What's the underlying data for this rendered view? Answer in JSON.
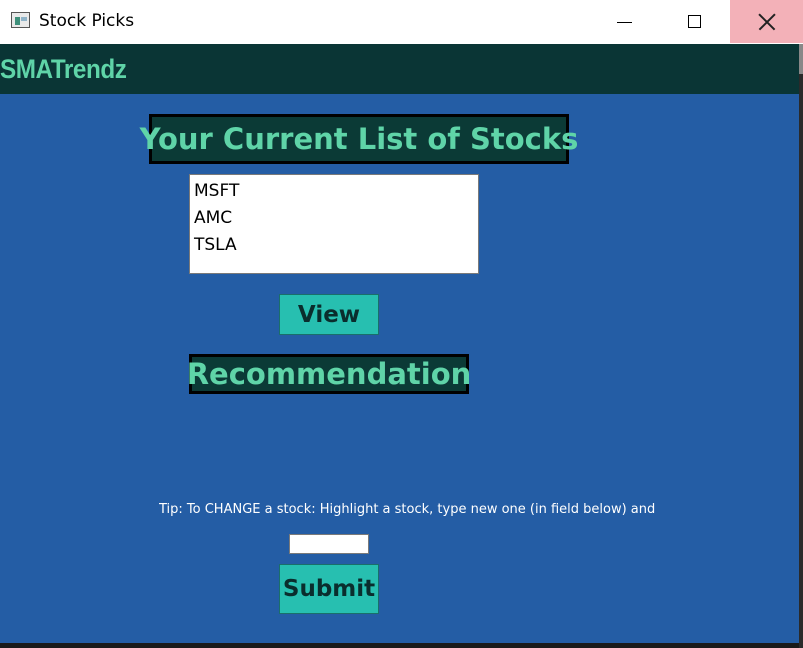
{
  "window": {
    "title": "Stock Picks",
    "controls": [
      "minimize-icon",
      "maximize-icon",
      "close-icon"
    ]
  },
  "header": {
    "brand": "SMATrendz"
  },
  "stocks_section": {
    "heading": "Your Current List of Stocks",
    "items": [
      "MSFT",
      "AMC",
      "TSLA"
    ]
  },
  "buttons": {
    "view": "View",
    "submit": "Submit"
  },
  "recommendation": {
    "heading": "Recommendation"
  },
  "tip": {
    "text": "Tip: To CHANGE a stock: Highlight a stock, type new one (in field below) and click S"
  },
  "entry": {
    "value": "",
    "placeholder": ""
  },
  "colors": {
    "header_bg": "#0a3535",
    "brand_text": "#5fd4a8",
    "main_bg": "#245da5",
    "heading_bg": "#0b3a36",
    "button_bg": "#27bfb0",
    "close_hover": "#f3b1b8"
  }
}
